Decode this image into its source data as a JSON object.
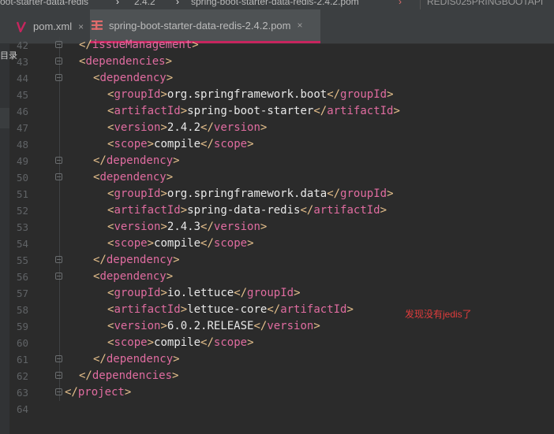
{
  "breadcrumb": {
    "item0": "oot-starter-data-redis",
    "item1": "2.4.2",
    "item2": "spring-boot-starter-data-redis-2.4.2.pom",
    "item3": "REDIS025PRINGBOOTAPI"
  },
  "side_stub": {
    "top_glyph": "‹",
    "label": "目录"
  },
  "tabs": [
    {
      "label": "pom.xml",
      "icon": "maven-icon",
      "icon_color": "#c7255e",
      "close": "×"
    },
    {
      "label": "spring-boot-starter-data-redis-2.4.2.pom",
      "icon": "pom-file-icon",
      "icon_color": "#e06c6c",
      "close": "×",
      "active": true
    }
  ],
  "colors": {
    "background": "#2b2b2b",
    "tag": "#e06ca0",
    "bracket": "#e6c08c",
    "text": "#e8e8e8",
    "line_number": "#606366",
    "active_tab_underline": "#c7255e",
    "annotation": "#e03c3c"
  },
  "code_lines": [
    {
      "n": "42",
      "indent": 1,
      "tag": "/issueManagement",
      "close": true
    },
    {
      "n": "43",
      "indent": 1,
      "tag": "dependencies"
    },
    {
      "n": "44",
      "indent": 2,
      "tag": "dependency"
    },
    {
      "n": "45",
      "indent": 3,
      "tag": "groupId",
      "value": "org.springframework.boot"
    },
    {
      "n": "46",
      "indent": 3,
      "tag": "artifactId",
      "value": "spring-boot-starter"
    },
    {
      "n": "47",
      "indent": 3,
      "tag": "version",
      "value": "2.4.2"
    },
    {
      "n": "48",
      "indent": 3,
      "tag": "scope",
      "value": "compile"
    },
    {
      "n": "49",
      "indent": 2,
      "tag": "/dependency",
      "close": true
    },
    {
      "n": "50",
      "indent": 2,
      "tag": "dependency"
    },
    {
      "n": "51",
      "indent": 3,
      "tag": "groupId",
      "value": "org.springframework.data"
    },
    {
      "n": "52",
      "indent": 3,
      "tag": "artifactId",
      "value": "spring-data-redis"
    },
    {
      "n": "53",
      "indent": 3,
      "tag": "version",
      "value": "2.4.3"
    },
    {
      "n": "54",
      "indent": 3,
      "tag": "scope",
      "value": "compile"
    },
    {
      "n": "55",
      "indent": 2,
      "tag": "/dependency",
      "close": true
    },
    {
      "n": "56",
      "indent": 2,
      "tag": "dependency"
    },
    {
      "n": "57",
      "indent": 3,
      "tag": "groupId",
      "value": "io.lettuce"
    },
    {
      "n": "58",
      "indent": 3,
      "tag": "artifactId",
      "value": "lettuce-core"
    },
    {
      "n": "59",
      "indent": 3,
      "tag": "version",
      "value": "6.0.2.RELEASE"
    },
    {
      "n": "60",
      "indent": 3,
      "tag": "scope",
      "value": "compile"
    },
    {
      "n": "61",
      "indent": 2,
      "tag": "/dependency",
      "close": true
    },
    {
      "n": "62",
      "indent": 1,
      "tag": "/dependencies",
      "close": true
    },
    {
      "n": "63",
      "indent": 0,
      "tag": "/project",
      "close": true
    },
    {
      "n": "64",
      "indent": 0,
      "tag": ""
    }
  ],
  "annotation": "发现没有jedis了"
}
